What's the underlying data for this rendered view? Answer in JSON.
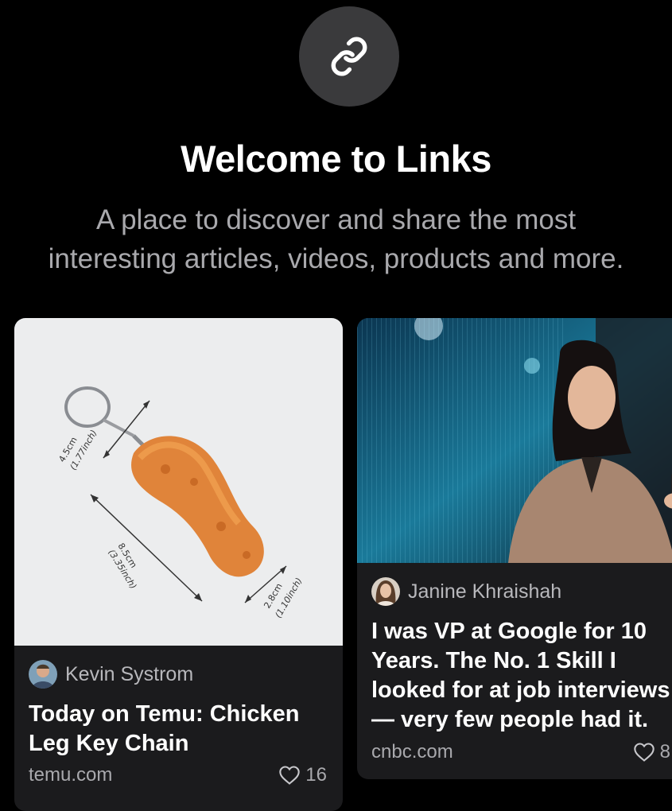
{
  "header": {
    "icon": "link-icon",
    "title": "Welcome to Links",
    "subtitle_line1": "A place to discover and share the most",
    "subtitle_line2": "interesting articles, videos, products and more."
  },
  "cards": [
    {
      "image": {
        "description_icon": "chicken-leg-keychain-image",
        "dimension_labels": [
          "4.5cm",
          "(1.77inch)",
          "8.5cm",
          "(3.35inch)",
          "2.8cm",
          "(1.10inch)"
        ]
      },
      "author": "Kevin Systrom",
      "headline_line1": "Today on Temu: Chicken",
      "headline_line2": "Leg Key Chain",
      "domain": "temu.com",
      "likes": "16"
    },
    {
      "image": {
        "description_icon": "woman-with-phone-photo"
      },
      "author": "Janine Khraishah",
      "headline_line1": "I was VP at Google for 10",
      "headline_line2": "Years. The No. 1 Skill I",
      "headline_line3": "looked for at job interviews",
      "headline_line4": "— very few people had it.",
      "domain": "cnbc.com",
      "likes": "8"
    }
  ],
  "colors": {
    "background": "#000000",
    "card": "#1b1b1d",
    "badge": "#3a3a3c",
    "muted_text": "#a9a9ad"
  }
}
